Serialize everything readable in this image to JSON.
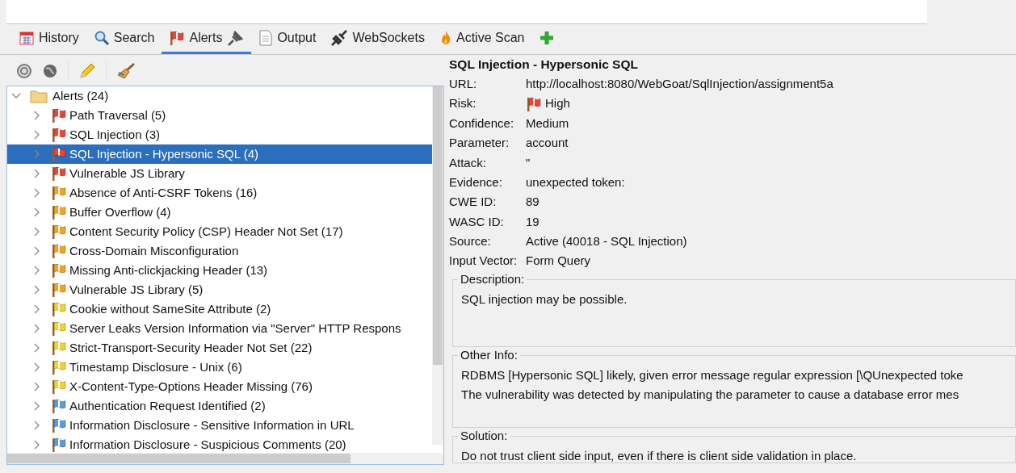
{
  "tabs": [
    {
      "label": "History",
      "selected": false
    },
    {
      "label": "Search",
      "selected": false
    },
    {
      "label": "Alerts",
      "selected": true
    },
    {
      "label": "Output",
      "selected": false
    },
    {
      "label": "WebSockets",
      "selected": false
    },
    {
      "label": "Active Scan",
      "selected": false
    }
  ],
  "tree": {
    "label": "Alerts (24)",
    "expanded": true,
    "children": [
      {
        "label": "Path Traversal (5)",
        "color": "#e8463a",
        "selected": false
      },
      {
        "label": "SQL Injection (3)",
        "color": "#e8463a",
        "selected": false
      },
      {
        "label": "SQL Injection - Hypersonic SQL (4)",
        "color": "#e8463a",
        "selected": true
      },
      {
        "label": "Vulnerable JS Library",
        "color": "#e8463a",
        "selected": false
      },
      {
        "label": "Absence of Anti-CSRF Tokens (16)",
        "color": "#f5a21c",
        "selected": false
      },
      {
        "label": "Buffer Overflow (4)",
        "color": "#f5a21c",
        "selected": false
      },
      {
        "label": "Content Security Policy (CSP) Header Not Set (17)",
        "color": "#f5a21c",
        "selected": false
      },
      {
        "label": "Cross-Domain Misconfiguration",
        "color": "#f5a21c",
        "selected": false
      },
      {
        "label": "Missing Anti-clickjacking Header (13)",
        "color": "#f5a21c",
        "selected": false
      },
      {
        "label": "Vulnerable JS Library (5)",
        "color": "#f5a21c",
        "selected": false
      },
      {
        "label": "Cookie without SameSite Attribute (2)",
        "color": "#f2d22e",
        "selected": false
      },
      {
        "label": "Server Leaks Version Information via \"Server\" HTTP Respons",
        "color": "#f2d22e",
        "selected": false
      },
      {
        "label": "Strict-Transport-Security Header Not Set (22)",
        "color": "#f2d22e",
        "selected": false
      },
      {
        "label": "Timestamp Disclosure - Unix (6)",
        "color": "#f2d22e",
        "selected": false
      },
      {
        "label": "X-Content-Type-Options Header Missing (76)",
        "color": "#f2d22e",
        "selected": false
      },
      {
        "label": "Authentication Request Identified (2)",
        "color": "#5b9bd5",
        "selected": false
      },
      {
        "label": "Information Disclosure - Sensitive Information in URL",
        "color": "#5b9bd5",
        "selected": false
      },
      {
        "label": "Information Disclosure - Suspicious Comments (20)",
        "color": "#5b9bd5",
        "selected": false
      }
    ]
  },
  "detail": {
    "title": "SQL Injection - Hypersonic SQL",
    "fields": [
      {
        "label": "URL:",
        "value": "http://localhost:8080/WebGoat/SqlInjection/assignment5a"
      },
      {
        "label": "Risk:",
        "value": "High",
        "kind": "risk",
        "color": "#e8463a"
      },
      {
        "label": "Confidence:",
        "value": "Medium"
      },
      {
        "label": "Parameter:",
        "value": "account"
      },
      {
        "label": "Attack:",
        "value": "\""
      },
      {
        "label": "Evidence:",
        "value": "unexpected token:"
      },
      {
        "label": "CWE ID:",
        "value": "89"
      },
      {
        "label": "WASC ID:",
        "value": "19"
      },
      {
        "label": "Source:",
        "value": "Active (40018 - SQL Injection)"
      },
      {
        "label": "Input Vector:",
        "value": "Form Query"
      }
    ],
    "sections": [
      {
        "title": "Description:",
        "lines": [
          "SQL injection may be possible."
        ]
      },
      {
        "title": "Other Info:",
        "lines": [
          "RDBMS [Hypersonic SQL] likely, given error message regular expression [\\QUnexpected toke",
          "The vulnerability was detected by manipulating the parameter to cause a database error mes"
        ]
      },
      {
        "title": "Solution:",
        "lines": [
          "Do not trust client side input, even if there is client side validation in place."
        ]
      }
    ]
  }
}
